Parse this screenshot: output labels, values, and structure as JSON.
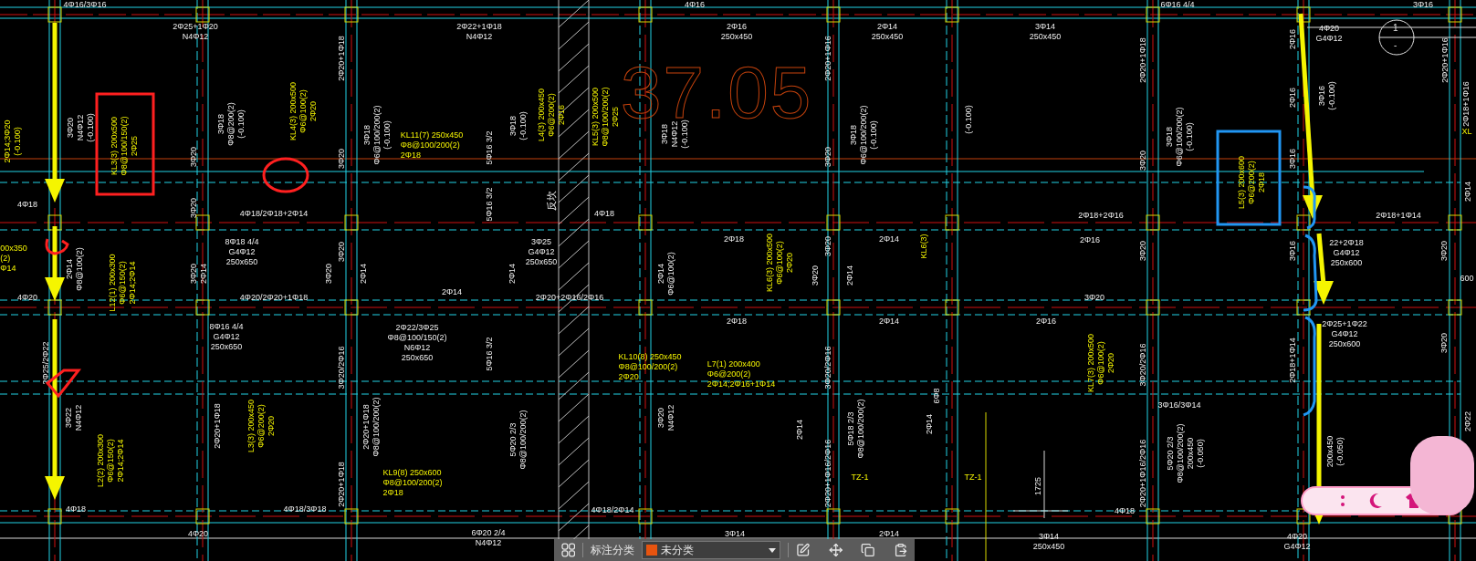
{
  "drawing": {
    "elevation": "37.05",
    "section_mark": {
      "number": "1",
      "sub": "-"
    },
    "annotations": [
      {
        "kind": "rebar",
        "vertical": false,
        "lines": [
          "4Φ16/3Φ16"
        ]
      },
      {
        "kind": "rebar",
        "vertical": false,
        "lines": [
          "2Φ25+1Φ20",
          "N4Φ12"
        ]
      },
      {
        "kind": "rebar",
        "vertical": true,
        "lines": [
          "2Φ20+1Φ18"
        ]
      },
      {
        "kind": "rebar",
        "vertical": false,
        "lines": [
          "2Φ22+1Φ18",
          "N4Φ12"
        ]
      },
      {
        "kind": "rebar",
        "vertical": false,
        "lines": [
          "4Φ16"
        ]
      },
      {
        "kind": "rebar",
        "vertical": false,
        "lines": [
          "2Φ16",
          "250x450"
        ]
      },
      {
        "kind": "rebar",
        "vertical": false,
        "lines": [
          "2Φ14",
          "250x450"
        ]
      },
      {
        "kind": "rebar",
        "vertical": true,
        "lines": [
          "2Φ20+1Φ16"
        ]
      },
      {
        "kind": "rebar",
        "vertical": false,
        "lines": [
          "6Φ16 4/4"
        ]
      },
      {
        "kind": "rebar",
        "vertical": false,
        "lines": [
          "3Φ16"
        ]
      },
      {
        "kind": "rebar",
        "vertical": false,
        "lines": [
          "3Φ14",
          "250x450"
        ]
      },
      {
        "kind": "rebar",
        "vertical": true,
        "lines": [
          "2Φ20+1Φ18"
        ]
      },
      {
        "kind": "rebar",
        "vertical": true,
        "lines": [
          "2Φ16"
        ]
      },
      {
        "kind": "rebar",
        "vertical": false,
        "lines": [
          "4Φ20",
          "G4Φ12"
        ]
      },
      {
        "kind": "rebar",
        "vertical": true,
        "lines": [
          "2Φ16"
        ]
      },
      {
        "kind": "rebar",
        "vertical": true,
        "lines": [
          "3Φ16",
          "(-0.100)"
        ]
      },
      {
        "kind": "rebar",
        "vertical": true,
        "lines": [
          "2Φ20+1Φ16"
        ]
      },
      {
        "kind": "rebar",
        "vertical": true,
        "lines": [
          "2Φ18+1Φ16"
        ]
      },
      {
        "kind": "beam",
        "vertical": false,
        "lines": [
          "XL"
        ]
      },
      {
        "kind": "beam",
        "vertical": true,
        "lines": [
          "2Φ14;3Φ20",
          "(-0.100)"
        ]
      },
      {
        "kind": "rebar",
        "vertical": true,
        "lines": [
          "3Φ20",
          "N4Φ12",
          "(-0.100)"
        ]
      },
      {
        "kind": "beam",
        "vertical": true,
        "lines": [
          "KL3(3) 200x500",
          "Φ8@100/150(2)",
          "2Φ25"
        ]
      },
      {
        "kind": "rebar",
        "vertical": true,
        "lines": [
          "3Φ18",
          "Φ8@200(2)",
          "(-0.100)"
        ]
      },
      {
        "kind": "beam",
        "vertical": true,
        "lines": [
          "KL4(3) 200x500",
          "Φ6@100(2)",
          "2Φ20"
        ]
      },
      {
        "kind": "rebar",
        "vertical": true,
        "lines": [
          "3Φ18",
          "Φ6@100/200(2)",
          "(-0.100)"
        ]
      },
      {
        "kind": "beam",
        "vertical": false,
        "lines": [
          "KL11(7) 250x450",
          "Φ8@100/200(2)",
          "2Φ18"
        ]
      },
      {
        "kind": "rebar",
        "vertical": true,
        "lines": [
          "5Φ16 3/2"
        ]
      },
      {
        "kind": "rebar",
        "vertical": true,
        "lines": [
          "3Φ18",
          "(-0.100)"
        ]
      },
      {
        "kind": "beam",
        "vertical": true,
        "lines": [
          "L4(3) 200x450",
          "Φ6@200(2)",
          "2Φ16"
        ]
      },
      {
        "kind": "beam",
        "vertical": true,
        "lines": [
          "KL5(3) 200x500",
          "Φ8@100/200(2)",
          "2Φ25"
        ]
      },
      {
        "kind": "rebar",
        "vertical": true,
        "lines": [
          "3Φ18",
          "N4Φ12",
          "(-0.100)"
        ]
      },
      {
        "kind": "rebar",
        "vertical": true,
        "lines": [
          "3Φ20"
        ]
      },
      {
        "kind": "rebar",
        "vertical": true,
        "lines": [
          "3Φ20"
        ]
      },
      {
        "kind": "rebar",
        "vertical": true,
        "lines": [
          "3Φ20"
        ]
      },
      {
        "kind": "rebar",
        "vertical": true,
        "lines": [
          "3Φ18",
          "Φ6@100/200(2)",
          "(-0.100)"
        ]
      },
      {
        "kind": "rebar",
        "vertical": true,
        "lines": [
          "(-0.100)"
        ]
      },
      {
        "kind": "rebar",
        "vertical": true,
        "lines": [
          "3Φ20"
        ]
      },
      {
        "kind": "rebar",
        "vertical": true,
        "lines": [
          "3Φ18",
          "Φ6@100/200(2)",
          "(-0.100)"
        ]
      },
      {
        "kind": "beam",
        "vertical": true,
        "lines": [
          "L5(3) 200x600",
          "Φ6@200(2)",
          "2Φ18"
        ]
      },
      {
        "kind": "rebar",
        "vertical": true,
        "lines": [
          "3Φ16"
        ]
      },
      {
        "kind": "rebar",
        "vertical": false,
        "lines": [
          "4Φ18"
        ]
      },
      {
        "kind": "rebar",
        "vertical": true,
        "lines": [
          "3Φ20"
        ]
      },
      {
        "kind": "rebar",
        "vertical": false,
        "lines": [
          "4Φ18/2Φ18+2Φ14"
        ]
      },
      {
        "kind": "rebar",
        "vertical": true,
        "lines": [
          "5Φ16 3/2"
        ]
      },
      {
        "kind": "rebar",
        "vertical": true,
        "lines": [
          "反坎"
        ]
      },
      {
        "kind": "rebar",
        "vertical": false,
        "lines": [
          "4Φ18"
        ]
      },
      {
        "kind": "rebar",
        "vertical": false,
        "lines": [
          "2Φ18+2Φ16"
        ]
      },
      {
        "kind": "rebar",
        "vertical": false,
        "lines": [
          "2Φ18+1Φ14"
        ]
      },
      {
        "kind": "rebar",
        "vertical": true,
        "lines": [
          "2Φ14"
        ]
      },
      {
        "kind": "beam",
        "vertical": false,
        "lines": [
          "00x350",
          "(2)",
          "Φ14"
        ]
      },
      {
        "kind": "rebar",
        "vertical": false,
        "lines": [
          "8Φ18 4/4",
          "G4Φ12",
          "250x650"
        ]
      },
      {
        "kind": "rebar",
        "vertical": false,
        "lines": [
          "3Φ25",
          "G4Φ12",
          "250x650"
        ]
      },
      {
        "kind": "rebar",
        "vertical": false,
        "lines": [
          "2Φ18"
        ]
      },
      {
        "kind": "rebar",
        "vertical": false,
        "lines": [
          "2Φ14"
        ]
      },
      {
        "kind": "rebar",
        "vertical": false,
        "lines": [
          "2Φ16"
        ]
      },
      {
        "kind": "rebar",
        "vertical": false,
        "lines": [
          "22+2Φ18",
          "G4Φ12",
          "250x600"
        ]
      },
      {
        "kind": "rebar",
        "vertical": true,
        "lines": [
          "3Φ20"
        ]
      },
      {
        "kind": "beam",
        "vertical": true,
        "lines": [
          "KL6(3) 200x500",
          "Φ6@100(2)",
          "2Φ20"
        ]
      },
      {
        "kind": "beam",
        "vertical": true,
        "lines": [
          "KL6(3)"
        ]
      },
      {
        "kind": "rebar",
        "vertical": true,
        "lines": [
          "3Φ20"
        ]
      },
      {
        "kind": "rebar",
        "vertical": true,
        "lines": [
          "3Φ20"
        ]
      },
      {
        "kind": "rebar",
        "vertical": true,
        "lines": [
          "3Φ16"
        ]
      },
      {
        "kind": "rebar",
        "vertical": true,
        "lines": [
          "3Φ20"
        ]
      },
      {
        "kind": "rebar",
        "vertical": false,
        "lines": [
          "600"
        ]
      },
      {
        "kind": "rebar",
        "vertical": true,
        "lines": [
          "2Φ14",
          "Φ8@100(2)"
        ]
      },
      {
        "kind": "rebar",
        "vertical": true,
        "lines": [
          "3Φ20",
          "2Φ14"
        ]
      },
      {
        "kind": "rebar",
        "vertical": true,
        "lines": [
          "3Φ20"
        ]
      },
      {
        "kind": "rebar",
        "vertical": true,
        "lines": [
          "2Φ14"
        ]
      },
      {
        "kind": "rebar",
        "vertical": true,
        "lines": [
          "2Φ14"
        ]
      },
      {
        "kind": "rebar",
        "vertical": true,
        "lines": [
          "2Φ14",
          "Φ6@100(2)"
        ]
      },
      {
        "kind": "rebar",
        "vertical": true,
        "lines": [
          "3Φ20"
        ]
      },
      {
        "kind": "rebar",
        "vertical": true,
        "lines": [
          "2Φ14"
        ]
      },
      {
        "kind": "beam",
        "vertical": true,
        "lines": [
          "L12(1) 200x300",
          "Φ6@150(2)",
          "2Φ14;2Φ14"
        ]
      },
      {
        "kind": "rebar",
        "vertical": false,
        "lines": [
          "4Φ20"
        ]
      },
      {
        "kind": "rebar",
        "vertical": false,
        "lines": [
          "4Φ20/2Φ20+1Φ18"
        ]
      },
      {
        "kind": "rebar",
        "vertical": false,
        "lines": [
          "2Φ14"
        ]
      },
      {
        "kind": "rebar",
        "vertical": false,
        "lines": [
          "2Φ20+2Φ16/2Φ16"
        ]
      },
      {
        "kind": "rebar",
        "vertical": false,
        "lines": [
          "3Φ20"
        ]
      },
      {
        "kind": "rebar",
        "vertical": false,
        "lines": [
          "8Φ16 4/4",
          "G4Φ12",
          "250x650"
        ]
      },
      {
        "kind": "rebar",
        "vertical": false,
        "lines": [
          "2Φ22/3Φ25",
          "Φ8@100/150(2)",
          "N6Φ12",
          "250x650"
        ]
      },
      {
        "kind": "rebar",
        "vertical": false,
        "lines": [
          "2Φ18"
        ]
      },
      {
        "kind": "rebar",
        "vertical": false,
        "lines": [
          "2Φ14"
        ]
      },
      {
        "kind": "rebar",
        "vertical": false,
        "lines": [
          "2Φ16"
        ]
      },
      {
        "kind": "rebar",
        "vertical": false,
        "lines": [
          "2Φ25+1Φ22",
          "G4Φ12",
          "250x600"
        ]
      },
      {
        "kind": "rebar",
        "vertical": true,
        "lines": [
          "5Φ16 3/2"
        ]
      },
      {
        "kind": "rebar",
        "vertical": true,
        "lines": [
          "3Φ20/2Φ16"
        ]
      },
      {
        "kind": "rebar",
        "vertical": true,
        "lines": [
          "3Φ20/2Φ16"
        ]
      },
      {
        "kind": "rebar",
        "vertical": true,
        "lines": [
          "3Φ20/2Φ16"
        ]
      },
      {
        "kind": "beam",
        "vertical": false,
        "lines": [
          "KL10(8) 250x450",
          "Φ8@100/200(2)",
          "2Φ20"
        ]
      },
      {
        "kind": "beam",
        "vertical": false,
        "lines": [
          "L7(1) 200x400",
          "Φ6@200(2)",
          "2Φ14;2Φ16+1Φ14"
        ]
      },
      {
        "kind": "beam",
        "vertical": true,
        "lines": [
          "KL7(3) 200x500",
          "Φ6@100(2)",
          "2Φ20"
        ]
      },
      {
        "kind": "rebar",
        "vertical": true,
        "lines": [
          "2Φ18+1Φ14"
        ]
      },
      {
        "kind": "rebar",
        "vertical": true,
        "lines": [
          "3Φ20"
        ]
      },
      {
        "kind": "rebar",
        "vertical": true,
        "lines": [
          "2Φ25/2Φ22"
        ]
      },
      {
        "kind": "rebar",
        "vertical": false,
        "lines": [
          "3Φ16/3Φ14"
        ]
      },
      {
        "kind": "rebar",
        "vertical": true,
        "lines": [
          "3Φ22",
          "N4Φ12"
        ]
      },
      {
        "kind": "rebar",
        "vertical": true,
        "lines": [
          "2Φ20+1Φ18"
        ]
      },
      {
        "kind": "beam",
        "vertical": true,
        "lines": [
          "L3(3) 200x450",
          "Φ6@200(2)",
          "2Φ20"
        ]
      },
      {
        "kind": "rebar",
        "vertical": true,
        "lines": [
          "2Φ20+1Φ18",
          "Φ8@100/200(2)"
        ]
      },
      {
        "kind": "rebar",
        "vertical": true,
        "lines": [
          "3Φ20",
          "N4Φ12"
        ]
      },
      {
        "kind": "rebar",
        "vertical": true,
        "lines": [
          "5Φ20 2/3",
          "Φ8@100/200(2)"
        ]
      },
      {
        "kind": "rebar",
        "vertical": true,
        "lines": [
          "2Φ14"
        ]
      },
      {
        "kind": "rebar",
        "vertical": true,
        "lines": [
          "5Φ18 2/3",
          "Φ8@100/200(2)"
        ]
      },
      {
        "kind": "rebar",
        "vertical": true,
        "lines": [
          "6Φ8"
        ]
      },
      {
        "kind": "rebar",
        "vertical": true,
        "lines": [
          "2Φ14"
        ]
      },
      {
        "kind": "rebar",
        "vertical": true,
        "lines": [
          "2Φ22"
        ]
      },
      {
        "kind": "beam",
        "vertical": true,
        "lines": [
          "L2(2) 200x300",
          "Φ6@150(2)",
          "2Φ14;2Φ14"
        ]
      },
      {
        "kind": "rebar",
        "vertical": true,
        "lines": [
          "2Φ20+1Φ18"
        ]
      },
      {
        "kind": "beam",
        "vertical": false,
        "lines": [
          "KL9(8) 250x600",
          "Φ8@100/200(2)",
          "2Φ18"
        ]
      },
      {
        "kind": "rebar",
        "vertical": true,
        "lines": [
          "2Φ20+1Φ16/2Φ16"
        ]
      },
      {
        "kind": "beam",
        "vertical": false,
        "lines": [
          "TZ-1"
        ]
      },
      {
        "kind": "beam",
        "vertical": false,
        "lines": [
          "TZ-1"
        ]
      },
      {
        "kind": "rebar",
        "vertical": true,
        "lines": [
          "2Φ20+1Φ16/2Φ16"
        ]
      },
      {
        "kind": "rebar",
        "vertical": true,
        "lines": [
          "5Φ20 2/3",
          "Φ8@100/200(2)",
          "200x450",
          "(-0.050)"
        ]
      },
      {
        "kind": "rebar",
        "vertical": true,
        "lines": [
          "200x450",
          "(-0.050)"
        ]
      },
      {
        "kind": "rebar",
        "vertical": true,
        "lines": [
          "1725"
        ]
      },
      {
        "kind": "rebar",
        "vertical": false,
        "lines": [
          "4Φ18"
        ]
      },
      {
        "kind": "rebar",
        "vertical": false,
        "lines": [
          "4Φ18/3Φ18"
        ]
      },
      {
        "kind": "rebar",
        "vertical": false,
        "lines": [
          "4Φ18/2Φ14"
        ]
      },
      {
        "kind": "rebar",
        "vertical": false,
        "lines": [
          "4Φ18"
        ]
      },
      {
        "kind": "rebar",
        "vertical": false,
        "lines": [
          "4Φ20"
        ]
      },
      {
        "kind": "rebar",
        "vertical": false,
        "lines": [
          "6Φ20 2/4",
          "N4Φ12"
        ]
      },
      {
        "kind": "rebar",
        "vertical": false,
        "lines": [
          "3Φ14"
        ]
      },
      {
        "kind": "rebar",
        "vertical": false,
        "lines": [
          "2Φ14"
        ]
      },
      {
        "kind": "rebar",
        "vertical": false,
        "lines": [
          "3Φ14",
          "250x450"
        ]
      },
      {
        "kind": "rebar",
        "vertical": false,
        "lines": [
          "4Φ20",
          "G4Φ12"
        ]
      }
    ]
  },
  "toolbar": {
    "label": "标注分类",
    "category": "未分类"
  }
}
